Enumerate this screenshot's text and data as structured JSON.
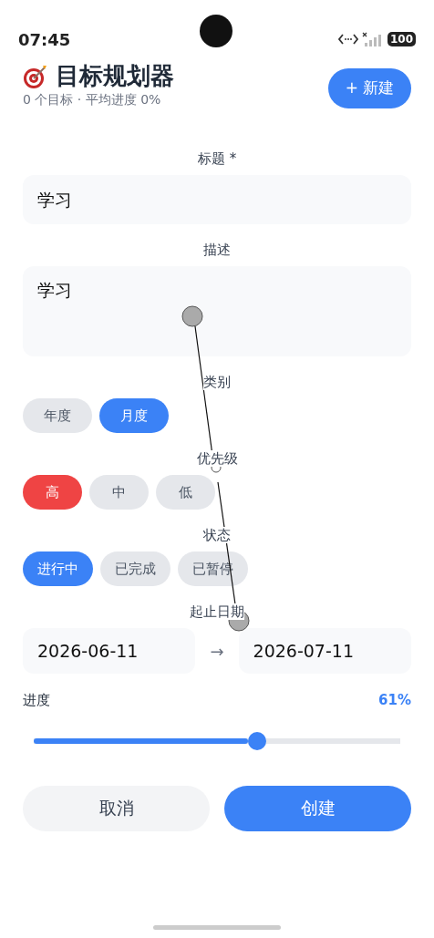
{
  "status_bar": {
    "time": "07:45",
    "battery": "100"
  },
  "header": {
    "title": "目标规划器",
    "subtitle": "0 个目标 · 平均进度 0%",
    "new_button": "+ 新建"
  },
  "form": {
    "title_label": "标题 *",
    "title_value": "学习",
    "description_label": "描述",
    "description_value": "学习",
    "groups": [
      {
        "label": "类别",
        "kind": "category",
        "options": [
          {
            "label": "年度",
            "selected": false
          },
          {
            "label": "月度",
            "selected": true
          }
        ]
      },
      {
        "label": "优先级",
        "kind": "priority",
        "options": [
          {
            "label": "高",
            "selected": true
          },
          {
            "label": "中",
            "selected": false
          },
          {
            "label": "低",
            "selected": false
          }
        ]
      },
      {
        "label": "状态",
        "kind": "status",
        "options": [
          {
            "label": "进行中",
            "selected": true
          },
          {
            "label": "已完成",
            "selected": false
          },
          {
            "label": "已暂停",
            "selected": false
          }
        ]
      }
    ],
    "date_label": "起止日期",
    "start_date": "2026-06-11",
    "date_separator": "→",
    "end_date": "2026-07-11",
    "progress_label": "进度",
    "progress_reading": "61%",
    "progress": {
      "level": 0.61
    },
    "buttons": [
      {
        "label": "取消",
        "kind": "secondary"
      },
      {
        "label": "创建",
        "kind": "primary"
      }
    ]
  }
}
